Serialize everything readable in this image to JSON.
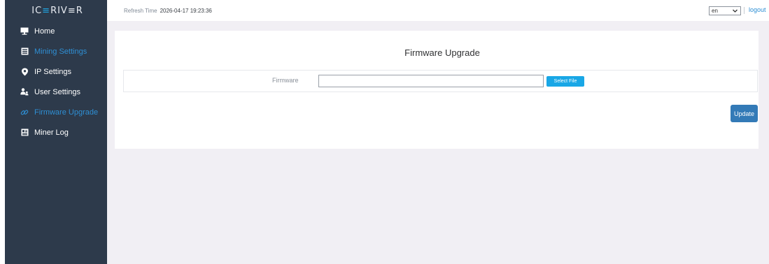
{
  "brand": {
    "prefix": "IC",
    "accent": "≡",
    "suffix": "RIV≡R",
    "accent_color": "#1fa3e0"
  },
  "sidebar": {
    "items": [
      {
        "label": "Home",
        "icon": "monitor-icon"
      },
      {
        "label": "Mining Settings",
        "icon": "server-icon"
      },
      {
        "label": "IP Settings",
        "icon": "location-pin-icon"
      },
      {
        "label": "User Settings",
        "icon": "users-icon"
      },
      {
        "label": "Firmware Upgrade",
        "icon": "link-icon"
      },
      {
        "label": "Miner Log",
        "icon": "log-icon"
      }
    ],
    "active_index": 4
  },
  "topbar": {
    "refresh_label": "Refresh Time",
    "refresh_value": "2026-04-17 19:23:36",
    "language_value": "en",
    "logout_label": "logout"
  },
  "page": {
    "title": "Firmware Upgrade",
    "firmware_label": "Firmware",
    "firmware_value": "",
    "select_file_label": "Select File",
    "update_label": "Update"
  },
  "colors": {
    "sidebar_bg": "#2d3a4b",
    "accent_blue": "#2e8fd4",
    "select_file_bg": "#19a7e6",
    "update_bg": "#337ab7"
  }
}
